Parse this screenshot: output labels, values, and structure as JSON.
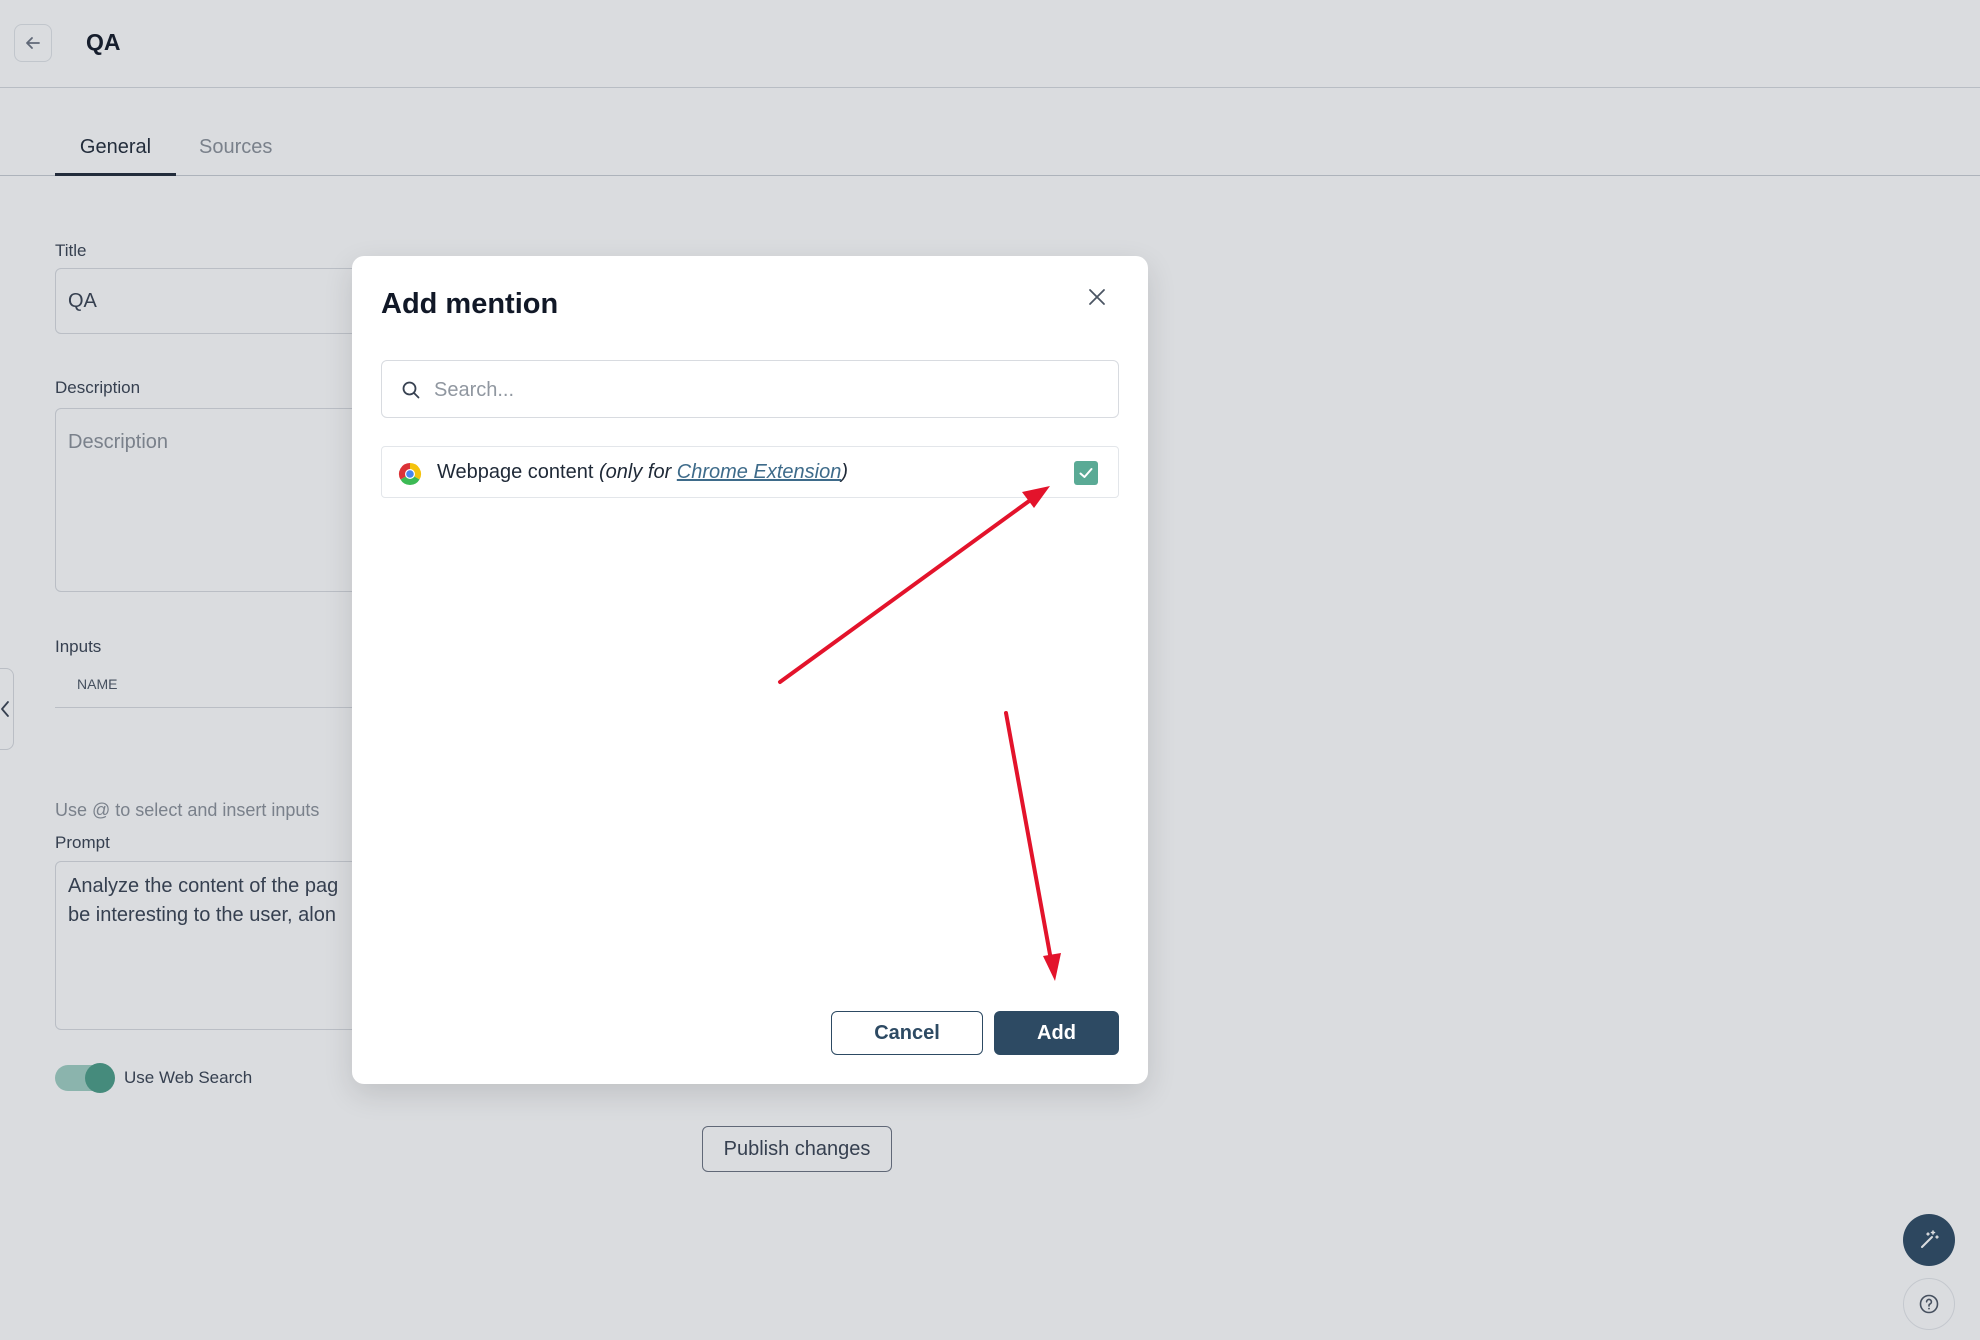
{
  "header": {
    "title": "QA"
  },
  "tabs": [
    {
      "label": "General",
      "active": true
    },
    {
      "label": "Sources",
      "active": false
    }
  ],
  "form": {
    "title_label": "Title",
    "title_value": "QA",
    "description_label": "Description",
    "description_placeholder": "Description",
    "inputs_label": "Inputs",
    "inputs_column": "NAME",
    "inputs_hint": "Use @ to select and insert inputs",
    "prompt_label": "Prompt",
    "prompt_line1": "Analyze the content of the pag",
    "prompt_line2": "be interesting to the user, alon",
    "web_search_label": "Use Web Search",
    "web_search_enabled": true
  },
  "publish_label": "Publish changes",
  "modal": {
    "title": "Add mention",
    "search_placeholder": "Search...",
    "option": {
      "label": "Webpage content",
      "note_prefix": "(only for ",
      "note_link": "Chrome Extension",
      "note_suffix": ")",
      "checked": true
    },
    "cancel_label": "Cancel",
    "add_label": "Add"
  },
  "colors": {
    "primary": "#2d4a63",
    "accent_green": "#5aaa95",
    "annotation_arrow": "#e3132b"
  },
  "icons": {
    "back": "arrow-left-icon",
    "close": "close-icon",
    "search": "search-icon",
    "option": "chrome-icon",
    "fab_magic": "magic-wand-icon",
    "fab_help": "help-icon"
  }
}
